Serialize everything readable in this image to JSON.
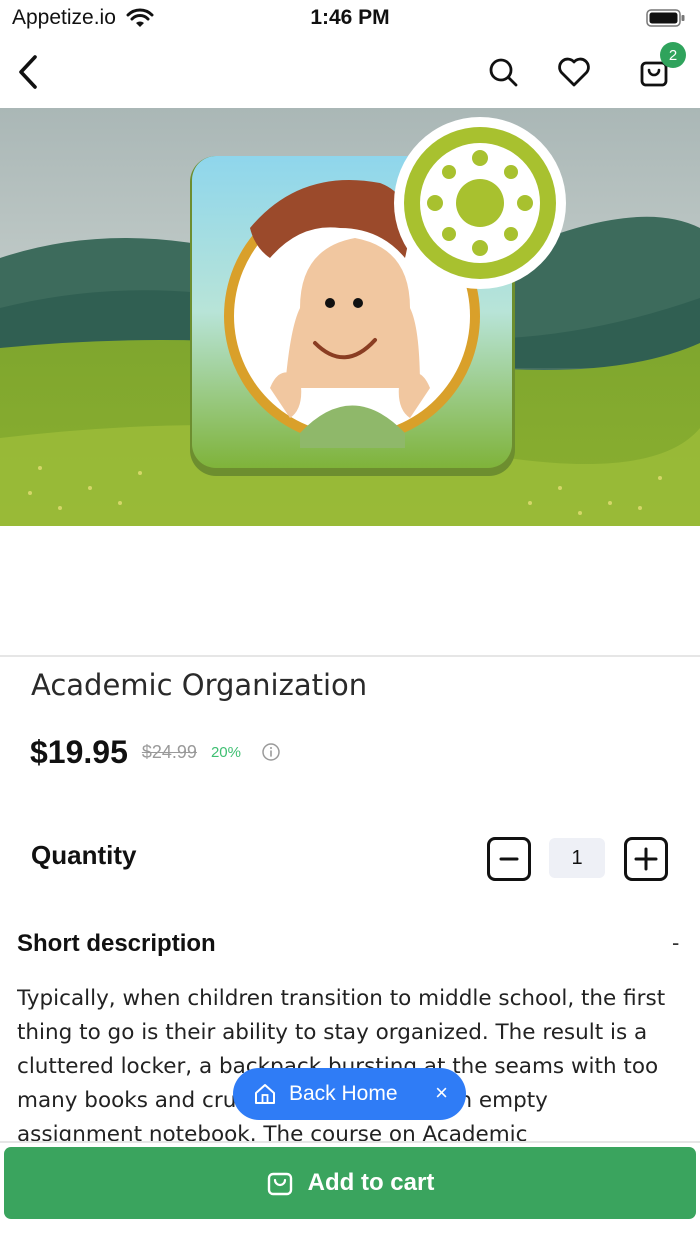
{
  "status_bar": {
    "carrier": "Appetize.io",
    "time": "1:46 PM"
  },
  "nav": {
    "cart_count": "2"
  },
  "product": {
    "title": "Academic Organization",
    "price": "$19.95",
    "old_price": "$24.99",
    "discount": "20%"
  },
  "quantity": {
    "label": "Quantity",
    "value": "1"
  },
  "description": {
    "title": "Short description",
    "toggle": "-",
    "text": "Typically, when children transition to middle school, the first thing to go is their ability to stay organized. The result is a cluttered locker, a backpack bursting at the seams with too many books and crumpled papers, and an empty assignment notebook. The course on Academic"
  },
  "back_home": {
    "label": "Back Home",
    "close": "×"
  },
  "add_to_cart": {
    "label": "Add to cart"
  },
  "colors": {
    "primary_green": "#3aa45e",
    "badge_green": "#2fa35c",
    "discount_green": "#3fbf72",
    "back_home_blue": "#2f7cf6"
  },
  "icons": [
    "back-arrow-icon",
    "search-icon",
    "heart-icon",
    "shopping-bag-icon",
    "info-icon",
    "home-icon",
    "wifi-icon",
    "battery-icon"
  ]
}
